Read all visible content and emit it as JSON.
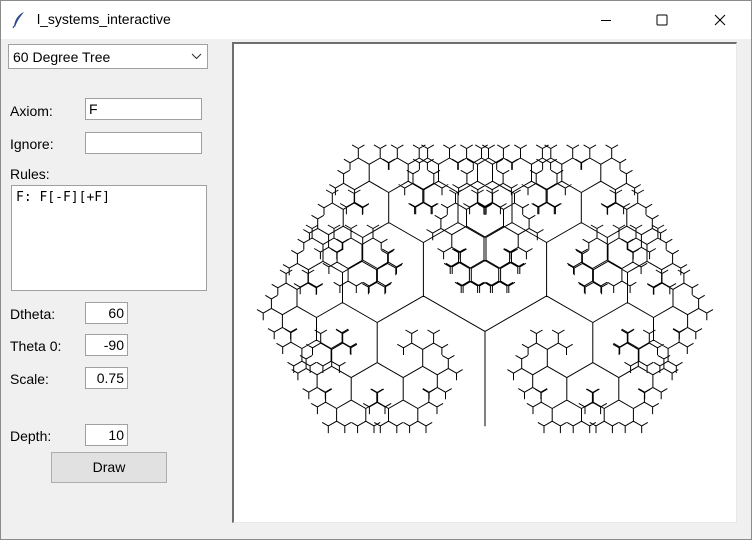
{
  "window": {
    "title": "l_systems_interactive"
  },
  "preset": {
    "selected": "60 Degree Tree"
  },
  "fields": {
    "axiom_label": "Axiom:",
    "axiom_value": "F",
    "ignore_label": "Ignore:",
    "ignore_value": "",
    "rules_label": "Rules:",
    "rules_value": "F: F[-F][+F]",
    "dtheta_label": "Dtheta:",
    "dtheta_value": "60",
    "theta0_label": "Theta 0:",
    "theta0_value": "-90",
    "scale_label": "Scale:",
    "scale_value": "0.75",
    "depth_label": "Depth:",
    "depth_value": "10"
  },
  "actions": {
    "draw_label": "Draw"
  },
  "lsystem": {
    "axiom": "F",
    "rule": "F[-F][+F]",
    "dtheta_deg": 60,
    "theta0_deg": -90,
    "scale": 0.75,
    "depth": 10,
    "stroke_color": "#000000"
  }
}
